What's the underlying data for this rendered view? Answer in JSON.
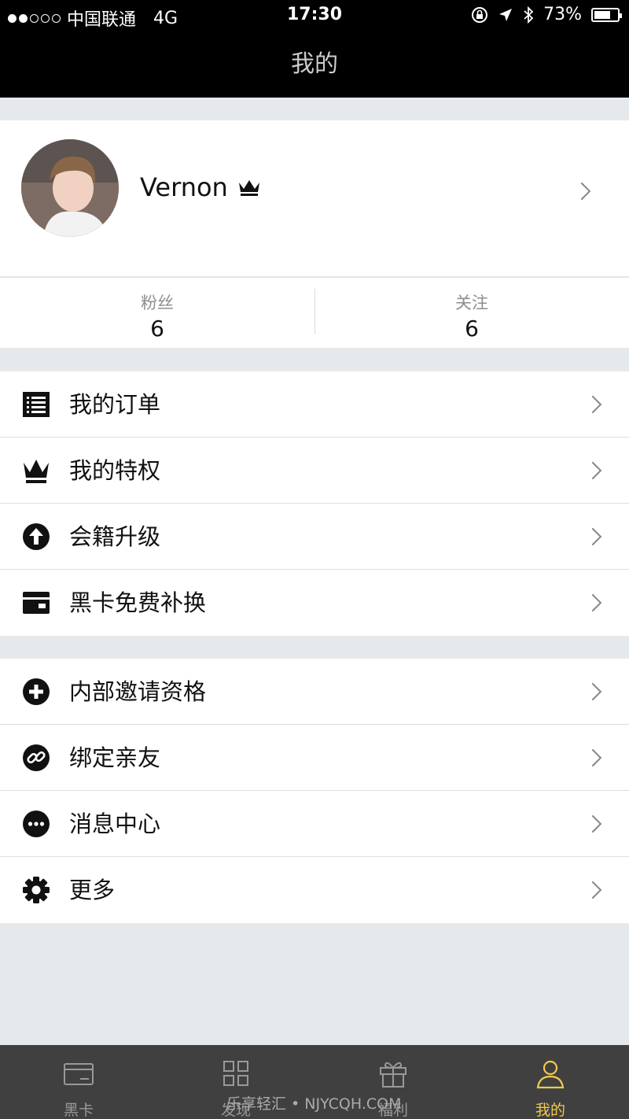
{
  "status_bar": {
    "carrier": "中国联通",
    "network": "4G",
    "time": "17:30",
    "battery": "73%",
    "battery_level": 0.73
  },
  "nav": {
    "title": "我的"
  },
  "profile": {
    "username": "Vernon"
  },
  "stats": [
    {
      "label": "粉丝",
      "value": "6"
    },
    {
      "label": "关注",
      "value": "6"
    }
  ],
  "menu_group_1": [
    {
      "label": "我的订单",
      "icon": "list-icon"
    },
    {
      "label": "我的特权",
      "icon": "crown-icon"
    },
    {
      "label": "会籍升级",
      "icon": "upgrade-arrow-icon"
    },
    {
      "label": "黑卡免费补换",
      "icon": "card-icon"
    }
  ],
  "menu_group_2": [
    {
      "label": "内部邀请资格",
      "icon": "plus-circle-icon"
    },
    {
      "label": "绑定亲友",
      "icon": "link-icon"
    },
    {
      "label": "消息中心",
      "icon": "message-dots-icon"
    },
    {
      "label": "更多",
      "icon": "gear-icon"
    }
  ],
  "tabs": [
    {
      "label": "黑卡",
      "icon": "card-tab-icon",
      "active": false
    },
    {
      "label": "发现",
      "icon": "grid-tab-icon",
      "active": false
    },
    {
      "label": "福利",
      "icon": "gift-tab-icon",
      "active": false
    },
    {
      "label": "我的",
      "icon": "person-tab-icon",
      "active": true
    }
  ],
  "colors": {
    "active_tab": "#f2c94c",
    "tab_bar": "#404040",
    "page_bg": "#e6e9ec"
  },
  "watermark": "乐享轻汇 • NJYCQH.COM"
}
